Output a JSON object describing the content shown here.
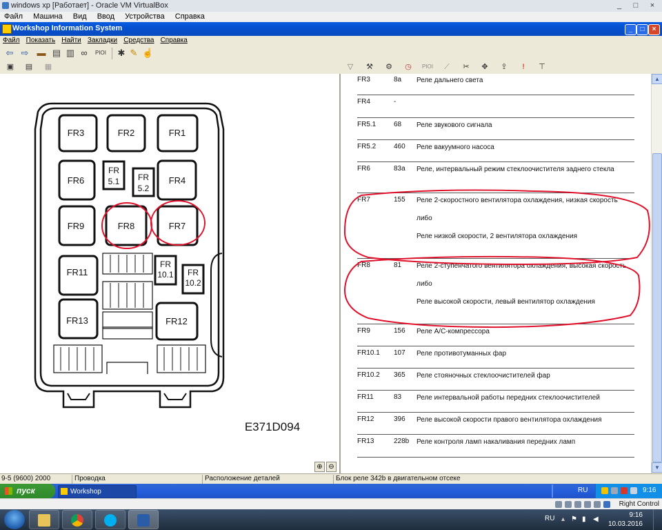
{
  "host": {
    "window_title": "windows xp [Работает] - Oracle VM VirtualBox",
    "menu": [
      "Файл",
      "Машина",
      "Вид",
      "Ввод",
      "Устройства",
      "Справка"
    ],
    "controls": [
      "_",
      "□",
      "×"
    ]
  },
  "app": {
    "window_title": "Workshop Information System",
    "menu": [
      "Файл",
      "Показать",
      "Найти",
      "Закладки",
      "Средства",
      "Справка"
    ],
    "toolbar_text": "PIOI",
    "toolbar2_text": "PIOI"
  },
  "diagram": {
    "caption": "E371D094",
    "labels": {
      "fr3": "FR3",
      "fr2": "FR2",
      "fr1": "FR1",
      "fr6": "FR6",
      "fr51a": "FR",
      "fr51b": "5.1",
      "fr52a": "FR",
      "fr52b": "5.2",
      "fr4": "FR4",
      "fr9": "FR9",
      "fr8": "FR8",
      "fr7": "FR7",
      "fr11": "FR11",
      "fr101a": "FR",
      "fr101b": "10.1",
      "fr102a": "FR",
      "fr102b": "10.2",
      "fr13": "FR13",
      "fr12": "FR12"
    }
  },
  "relay_table": [
    {
      "code": "FR3",
      "num": "8a",
      "desc": [
        "Реле дальнего света"
      ]
    },
    {
      "code": "FR4",
      "num": "-",
      "desc": [
        ""
      ]
    },
    {
      "code": "FR5.1",
      "num": "68",
      "desc": [
        "Реле звукового сигнала"
      ]
    },
    {
      "code": "FR5.2",
      "num": "460",
      "desc": [
        "Реле вакуумного насоса"
      ]
    },
    {
      "code": "FR6",
      "num": "83a",
      "desc": [
        "Реле, интервальный режим стеклоочистителя заднего стекла"
      ]
    },
    {
      "code": "FR7",
      "num": "155",
      "desc": [
        "Реле 2-скоростного вентилятора охлаждения, низкая скорость",
        "либо",
        "Реле низкой скорости, 2 вентилятора охлаждения"
      ]
    },
    {
      "code": "FR8",
      "num": "81",
      "desc": [
        "Реле 2-ступенчатого вентилятора охлаждения, высокая скорость",
        "либо",
        "Реле высокой скорости, левый вентилятор охлаждения"
      ]
    },
    {
      "code": "FR9",
      "num": "156",
      "desc": [
        "Реле A/C-компрессора"
      ]
    },
    {
      "code": "FR10.1",
      "num": "107",
      "desc": [
        "Реле противотуманных фар"
      ]
    },
    {
      "code": "FR10.2",
      "num": "365",
      "desc": [
        "Реле стояночных стеклоочистителей фар"
      ]
    },
    {
      "code": "FR11",
      "num": "83",
      "desc": [
        "Реле интервальной работы передних стеклоочистителей"
      ]
    },
    {
      "code": "FR12",
      "num": "396",
      "desc": [
        "Реле высокой скорости правого вентилятора охлаждения"
      ]
    },
    {
      "code": "FR13",
      "num": "228b",
      "desc": [
        "Реле контроля ламп накаливания передних ламп"
      ]
    }
  ],
  "statusbar": {
    "model": "9-5 (9600) 2000",
    "section": "Проводка",
    "view": "Расположение деталей",
    "location": "Блок реле 342b в двигательном отсеке"
  },
  "xp_taskbar": {
    "start_label": "пуск",
    "task_label": "Workshop Informatio...",
    "lang": "RU",
    "time": "9:16"
  },
  "vbox_status": {
    "host_key": "Right Control"
  },
  "win7_taskbar": {
    "lang": "RU",
    "time": "9:16",
    "date": "10.03.2016"
  },
  "colors": {
    "annotation_red": "#e0102a",
    "xp_title_blue": "#0550cf",
    "xp_start_green": "#2f8a2a"
  }
}
